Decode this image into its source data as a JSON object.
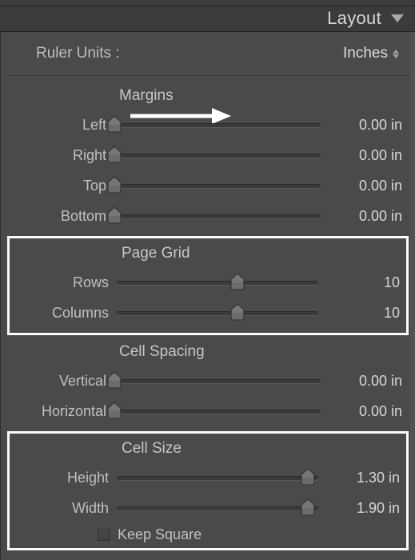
{
  "panel": {
    "title": "Layout"
  },
  "rulerUnits": {
    "label": "Ruler Units :",
    "value": "Inches"
  },
  "margins": {
    "title": "Margins",
    "left": {
      "label": "Left",
      "value": "0.00 in",
      "pos": 0
    },
    "right": {
      "label": "Right",
      "value": "0.00 in",
      "pos": 0
    },
    "top": {
      "label": "Top",
      "value": "0.00 in",
      "pos": 0
    },
    "bottom": {
      "label": "Bottom",
      "value": "0.00 in",
      "pos": 0
    }
  },
  "pageGrid": {
    "title": "Page Grid",
    "rows": {
      "label": "Rows",
      "value": "10",
      "pos": 60
    },
    "columns": {
      "label": "Columns",
      "value": "10",
      "pos": 60
    }
  },
  "cellSpacing": {
    "title": "Cell Spacing",
    "vertical": {
      "label": "Vertical",
      "value": "0.00 in",
      "pos": 0
    },
    "horizontal": {
      "label": "Horizontal",
      "value": "0.00 in",
      "pos": 0
    }
  },
  "cellSize": {
    "title": "Cell Size",
    "height": {
      "label": "Height",
      "value": "1.30 in",
      "pos": 95
    },
    "width": {
      "label": "Width",
      "value": "1.90 in",
      "pos": 95
    },
    "keepSquare": {
      "label": "Keep Square",
      "checked": false
    }
  }
}
